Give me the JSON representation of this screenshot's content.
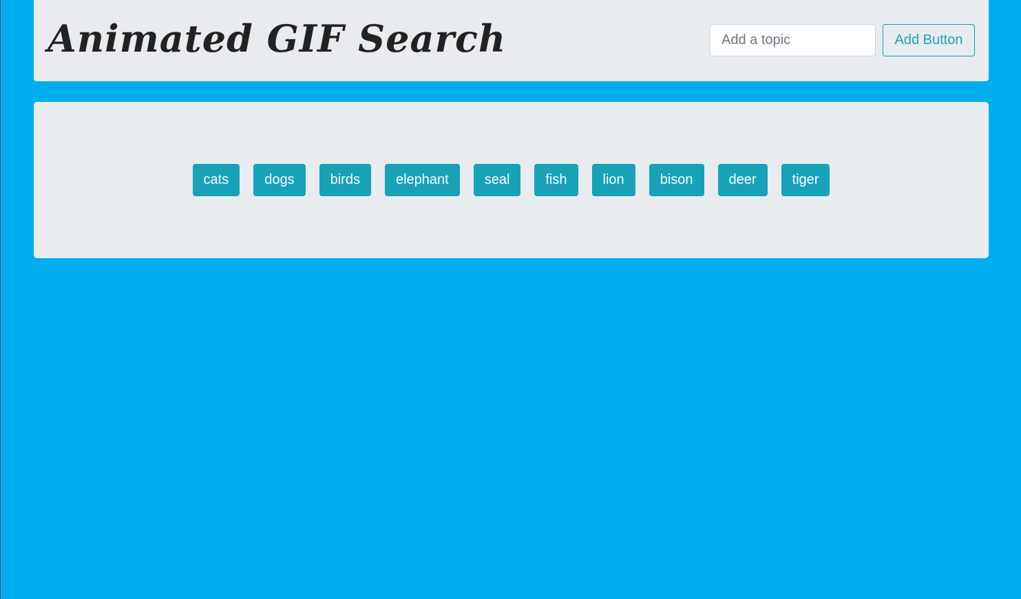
{
  "header": {
    "title": "Animated GIF Search",
    "input_placeholder": "Add a topic",
    "input_value": "",
    "add_button_label": "Add Button"
  },
  "topics": [
    "cats",
    "dogs",
    "birds",
    "elephant",
    "seal",
    "fish",
    "lion",
    "bison",
    "deer",
    "tiger"
  ],
  "colors": {
    "background": "#00adee",
    "panel": "#e9ecef",
    "accent": "#17a2b8"
  }
}
